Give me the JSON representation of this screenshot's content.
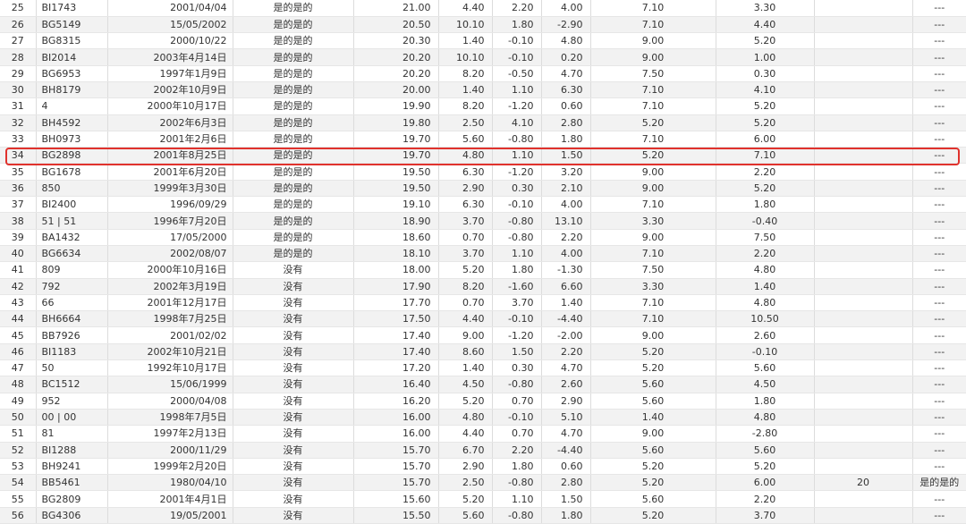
{
  "highlight_color": "#e0322d",
  "rows": [
    [
      "25",
      "BI1743",
      "2001/04/04",
      "是的是的",
      "21.00",
      "4.40",
      "2.20",
      "4.00",
      "7.10",
      "3.30",
      "",
      "---"
    ],
    [
      "26",
      "BG5149",
      "15/05/2002",
      "是的是的",
      "20.50",
      "10.10",
      "1.80",
      "-2.90",
      "7.10",
      "4.40",
      "",
      "---"
    ],
    [
      "27",
      "BG8315",
      "2000/10/22",
      "是的是的",
      "20.30",
      "1.40",
      "-0.10",
      "4.80",
      "9.00",
      "5.20",
      "",
      "---"
    ],
    [
      "28",
      "BI2014",
      "2003年4月14日",
      "是的是的",
      "20.20",
      "10.10",
      "-0.10",
      "0.20",
      "9.00",
      "1.00",
      "",
      "---"
    ],
    [
      "29",
      "BG6953",
      "1997年1月9日",
      "是的是的",
      "20.20",
      "8.20",
      "-0.50",
      "4.70",
      "7.50",
      "0.30",
      "",
      "---"
    ],
    [
      "30",
      "BH8179",
      "2002年10月9日",
      "是的是的",
      "20.00",
      "1.40",
      "1.10",
      "6.30",
      "7.10",
      "4.10",
      "",
      "---"
    ],
    [
      "31",
      "4",
      "2000年10月17日",
      "是的是的",
      "19.90",
      "8.20",
      "-1.20",
      "0.60",
      "7.10",
      "5.20",
      "",
      "---"
    ],
    [
      "32",
      "BH4592",
      "2002年6月3日",
      "是的是的",
      "19.80",
      "2.50",
      "4.10",
      "2.80",
      "5.20",
      "5.20",
      "",
      "---"
    ],
    [
      "33",
      "BH0973",
      "2001年2月6日",
      "是的是的",
      "19.70",
      "5.60",
      "-0.80",
      "1.80",
      "7.10",
      "6.00",
      "",
      "---"
    ],
    [
      "34",
      "BG2898",
      "2001年8月25日",
      "是的是的",
      "19.70",
      "4.80",
      "1.10",
      "1.50",
      "5.20",
      "7.10",
      "",
      "---"
    ],
    [
      "35",
      "BG1678",
      "2001年6月20日",
      "是的是的",
      "19.50",
      "6.30",
      "-1.20",
      "3.20",
      "9.00",
      "2.20",
      "",
      "---"
    ],
    [
      "36",
      "850",
      "1999年3月30日",
      "是的是的",
      "19.50",
      "2.90",
      "0.30",
      "2.10",
      "9.00",
      "5.20",
      "",
      "---"
    ],
    [
      "37",
      "BI2400",
      "1996/09/29",
      "是的是的",
      "19.10",
      "6.30",
      "-0.10",
      "4.00",
      "7.10",
      "1.80",
      "",
      "---"
    ],
    [
      "38",
      "51 | 51",
      "1996年7月20日",
      "是的是的",
      "18.90",
      "3.70",
      "-0.80",
      "13.10",
      "3.30",
      "-0.40",
      "",
      "---"
    ],
    [
      "39",
      "BA1432",
      "17/05/2000",
      "是的是的",
      "18.60",
      "0.70",
      "-0.80",
      "2.20",
      "9.00",
      "7.50",
      "",
      "---"
    ],
    [
      "40",
      "BG6634",
      "2002/08/07",
      "是的是的",
      "18.10",
      "3.70",
      "1.10",
      "4.00",
      "7.10",
      "2.20",
      "",
      "---"
    ],
    [
      "41",
      "809",
      "2000年10月16日",
      "没有",
      "18.00",
      "5.20",
      "1.80",
      "-1.30",
      "7.50",
      "4.80",
      "",
      "---"
    ],
    [
      "42",
      "792",
      "2002年3月19日",
      "没有",
      "17.90",
      "8.20",
      "-1.60",
      "6.60",
      "3.30",
      "1.40",
      "",
      "---"
    ],
    [
      "43",
      "66",
      "2001年12月17日",
      "没有",
      "17.70",
      "0.70",
      "3.70",
      "1.40",
      "7.10",
      "4.80",
      "",
      "---"
    ],
    [
      "44",
      "BH6664",
      "1998年7月25日",
      "没有",
      "17.50",
      "4.40",
      "-0.10",
      "-4.40",
      "7.10",
      "10.50",
      "",
      "---"
    ],
    [
      "45",
      "BB7926",
      "2001/02/02",
      "没有",
      "17.40",
      "9.00",
      "-1.20",
      "-2.00",
      "9.00",
      "2.60",
      "",
      "---"
    ],
    [
      "46",
      "BI1183",
      "2002年10月21日",
      "没有",
      "17.40",
      "8.60",
      "1.50",
      "2.20",
      "5.20",
      "-0.10",
      "",
      "---"
    ],
    [
      "47",
      "50",
      "1992年10月17日",
      "没有",
      "17.20",
      "1.40",
      "0.30",
      "4.70",
      "5.20",
      "5.60",
      "",
      "---"
    ],
    [
      "48",
      "BC1512",
      "15/06/1999",
      "没有",
      "16.40",
      "4.50",
      "-0.80",
      "2.60",
      "5.60",
      "4.50",
      "",
      "---"
    ],
    [
      "49",
      "952",
      "2000/04/08",
      "没有",
      "16.20",
      "5.20",
      "0.70",
      "2.90",
      "5.60",
      "1.80",
      "",
      "---"
    ],
    [
      "50",
      "00 | 00",
      "1998年7月5日",
      "没有",
      "16.00",
      "4.80",
      "-0.10",
      "5.10",
      "1.40",
      "4.80",
      "",
      "---"
    ],
    [
      "51",
      "81",
      "1997年2月13日",
      "没有",
      "16.00",
      "4.40",
      "0.70",
      "4.70",
      "9.00",
      "-2.80",
      "",
      "---"
    ],
    [
      "52",
      "BI1288",
      "2000/11/29",
      "没有",
      "15.70",
      "6.70",
      "2.20",
      "-4.40",
      "5.60",
      "5.60",
      "",
      "---"
    ],
    [
      "53",
      "BH9241",
      "1999年2月20日",
      "没有",
      "15.70",
      "2.90",
      "1.80",
      "0.60",
      "5.20",
      "5.20",
      "",
      "---"
    ],
    [
      "54",
      "BB5461",
      "1980/04/10",
      "没有",
      "15.70",
      "2.50",
      "-0.80",
      "2.80",
      "5.20",
      "6.00",
      "20",
      "是的是的"
    ],
    [
      "55",
      "BG2809",
      "2001年4月1日",
      "没有",
      "15.60",
      "5.20",
      "1.10",
      "1.50",
      "5.60",
      "2.20",
      "",
      "---"
    ],
    [
      "56",
      "BG4306",
      "19/05/2001",
      "没有",
      "15.50",
      "5.60",
      "-0.80",
      "1.80",
      "5.20",
      "3.70",
      "",
      "---"
    ]
  ]
}
